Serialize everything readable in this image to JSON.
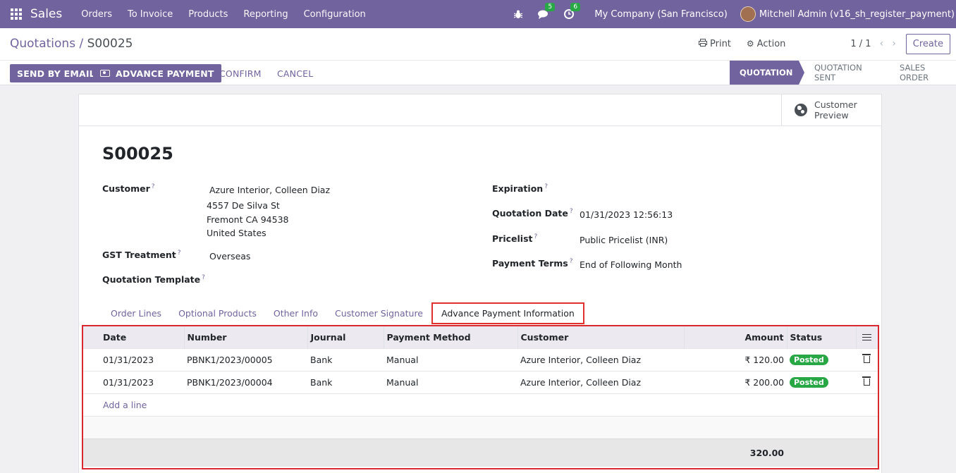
{
  "navbar": {
    "app_name": "Sales",
    "menu": [
      "Orders",
      "To Invoice",
      "Products",
      "Reporting",
      "Configuration"
    ],
    "messages_count": "5",
    "activities_count": "6",
    "company": "My Company (San Francisco)",
    "user": "Mitchell Admin (v16_sh_register_payment)"
  },
  "breadcrumb": {
    "parent": "Quotations",
    "separator": " / ",
    "current": "S00025"
  },
  "control": {
    "print_label": "Print",
    "action_label": "Action",
    "pager": "1 / 1",
    "create_label": "Create"
  },
  "buttons": {
    "send_email": "SEND BY EMAIL",
    "advance_payment": "ADVANCE PAYMENT",
    "confirm": "CONFIRM",
    "cancel": "CANCEL"
  },
  "statusbar": [
    "QUOTATION",
    "QUOTATION SENT",
    "SALES ORDER"
  ],
  "smart_button": {
    "line1": "Customer",
    "line2": "Preview"
  },
  "form": {
    "title": "S00025",
    "customer_label": "Customer",
    "customer_name": "Azure Interior, Colleen Diaz",
    "address_street": "4557 De Silva St",
    "address_city": "Fremont CA 94538",
    "address_country": "United States",
    "gst_label": "GST Treatment",
    "gst_value": "Overseas",
    "template_label": "Quotation Template",
    "expiration_label": "Expiration",
    "quotation_date_label": "Quotation Date",
    "quotation_date_value": "01/31/2023 12:56:13",
    "pricelist_label": "Pricelist",
    "pricelist_value": "Public Pricelist (INR)",
    "payment_terms_label": "Payment Terms",
    "payment_terms_value": "End of Following Month",
    "help_mark": "?"
  },
  "tabs": [
    "Order Lines",
    "Optional Products",
    "Other Info",
    "Customer Signature",
    "Advance Payment Information"
  ],
  "table": {
    "columns": [
      "Date",
      "Number",
      "Journal",
      "Payment Method",
      "Customer",
      "Amount",
      "Status"
    ],
    "rows": [
      {
        "date": "01/31/2023",
        "number": "PBNK1/2023/00005",
        "journal": "Bank",
        "method": "Manual",
        "customer": "Azure Interior, Colleen Diaz",
        "amount": "₹ 120.00",
        "status": "Posted"
      },
      {
        "date": "01/31/2023",
        "number": "PBNK1/2023/00004",
        "journal": "Bank",
        "method": "Manual",
        "customer": "Azure Interior, Colleen Diaz",
        "amount": "₹ 200.00",
        "status": "Posted"
      }
    ],
    "add_line": "Add a line",
    "total": "320.00"
  },
  "colors": {
    "brand": "#71639e",
    "posted": "#28a745",
    "highlight": "#d9282f"
  }
}
